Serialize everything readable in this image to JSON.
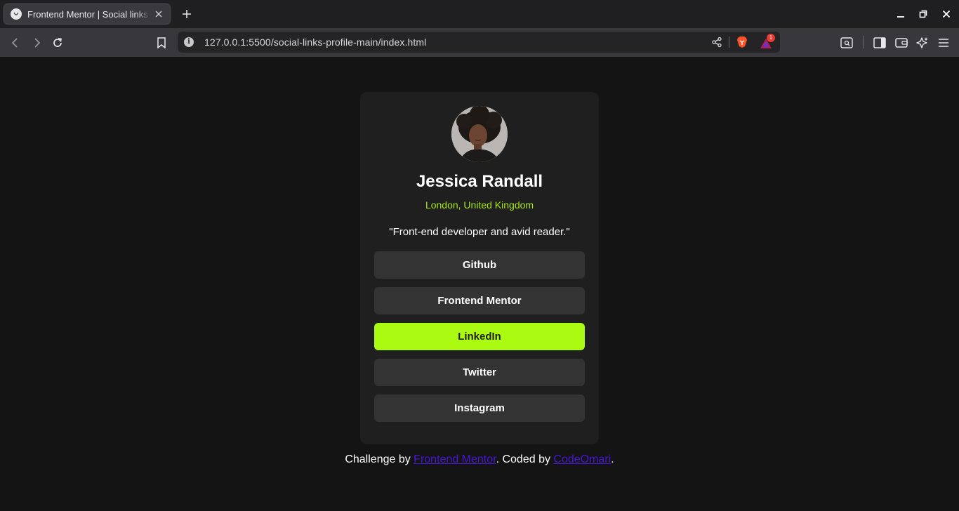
{
  "browser": {
    "tab_title": "Frontend Mentor | Social links profile",
    "url": "127.0.0.1:5500/social-links-profile-main/index.html",
    "notification_count": "1"
  },
  "profile": {
    "name": "Jessica Randall",
    "location": "London, United Kingdom",
    "bio": "\"Front-end developer and avid reader.\"",
    "links": [
      {
        "label": "Github"
      },
      {
        "label": "Frontend Mentor"
      },
      {
        "label": "LinkedIn"
      },
      {
        "label": "Twitter"
      },
      {
        "label": "Instagram"
      }
    ]
  },
  "footer": {
    "prefix": "Challenge by ",
    "link1": "Frontend Mentor",
    "middle": ". Coded by ",
    "link2": "CodeOmari",
    "suffix": "."
  },
  "colors": {
    "page_bg": "#141414",
    "card_bg": "#1f1f1f",
    "button_bg": "#333333",
    "accent": "#aafb11",
    "location": "#a8e817",
    "footer_link": "#4916d8"
  }
}
